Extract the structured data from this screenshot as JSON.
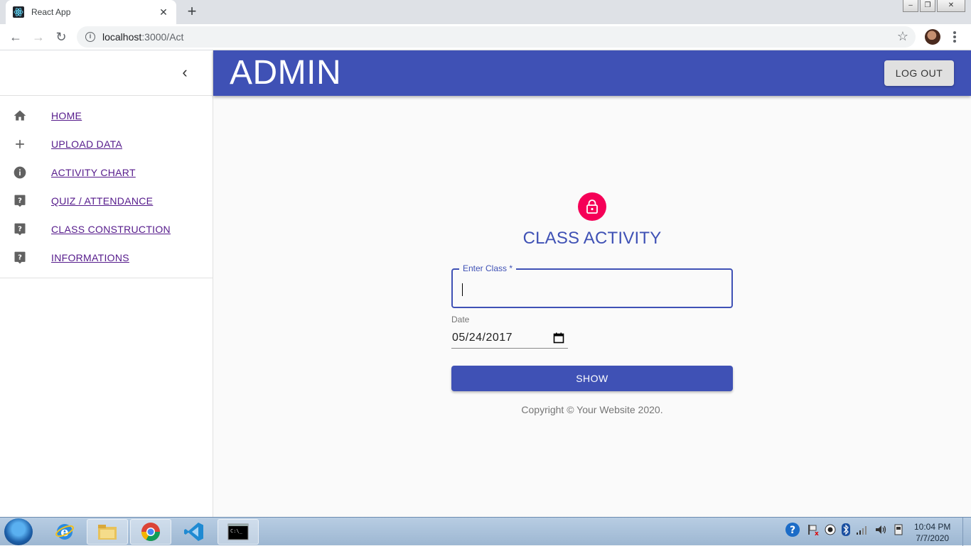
{
  "browser": {
    "tab_title": "React App",
    "tab_close": "✕",
    "new_tab": "+",
    "url_host": "localhost",
    "url_path": ":3000/Act",
    "star": "☆"
  },
  "drawer": {
    "collapse": "‹",
    "items": [
      {
        "label": "HOME",
        "icon": "home-icon"
      },
      {
        "label": "UPLOAD DATA",
        "icon": "plus-icon"
      },
      {
        "label": "ACTIVITY CHART",
        "icon": "info-icon"
      },
      {
        "label": "QUIZ / ATTENDANCE",
        "icon": "help-icon"
      },
      {
        "label": "CLASS CONSTRUCTION",
        "icon": "help-icon"
      },
      {
        "label": "INFORMATIONS",
        "icon": "help-icon"
      }
    ]
  },
  "appbar": {
    "title": "ADMIN",
    "logout_label": "LOG OUT"
  },
  "form": {
    "title": "CLASS ACTIVITY",
    "class_label": "Enter Class *",
    "class_value": "",
    "date_label": "Date",
    "date_value": "05/24/2017",
    "submit_label": "SHOW",
    "copyright": "Copyright © Your Website 2020."
  },
  "taskbar": {
    "time": "10:04 PM",
    "date": "7/7/2020"
  },
  "colors": {
    "primary": "#3f51b5",
    "secondary": "#f50057"
  }
}
